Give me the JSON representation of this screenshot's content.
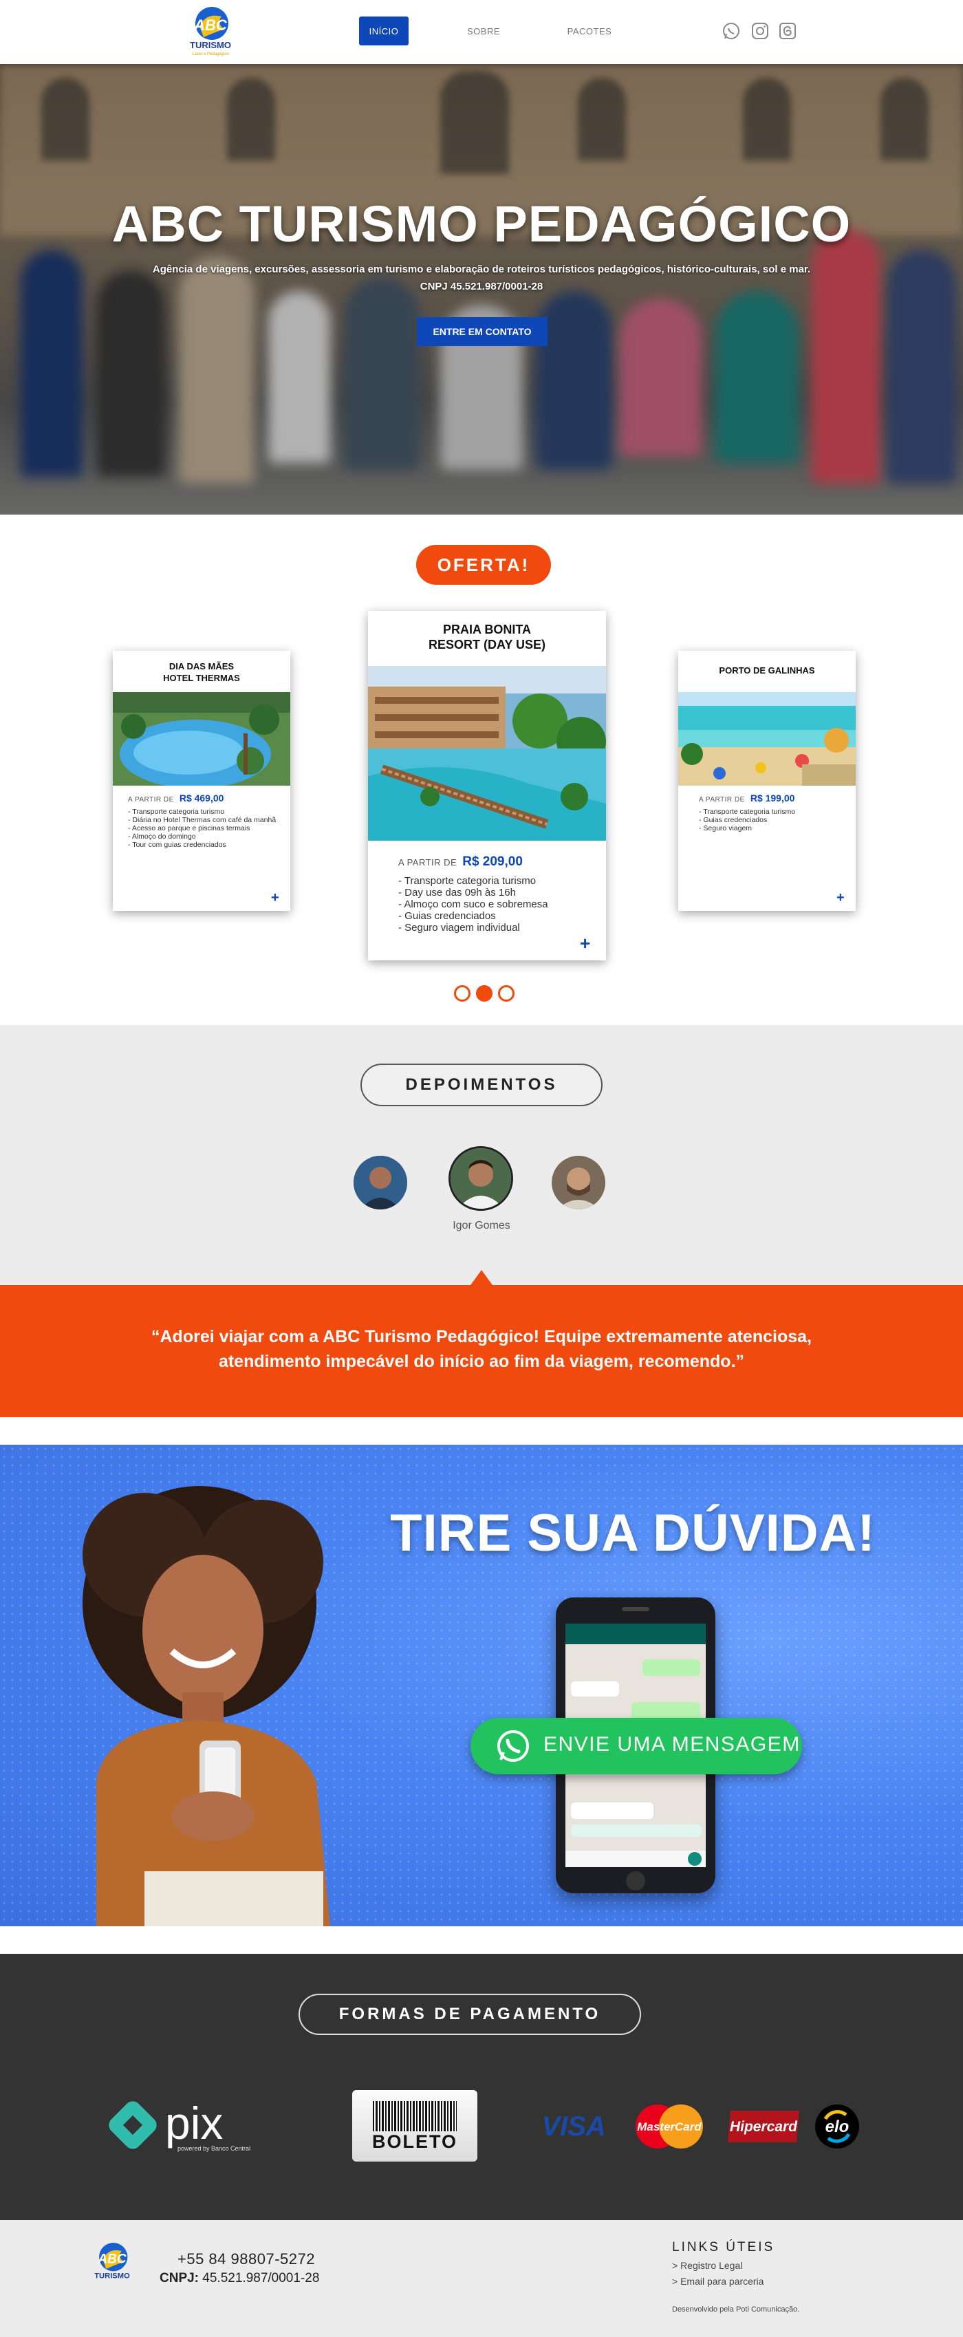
{
  "header": {
    "logo_text": "ABC TURISMO",
    "nav": [
      "INÍCIO",
      "SOBRE",
      "PACOTES"
    ],
    "social_icons": [
      "whatsapp-icon",
      "instagram-icon",
      "threads-icon"
    ]
  },
  "hero": {
    "title": "ABC TURISMO PEDAGÓGICO",
    "subtitle": "Agência de viagens, excursões, assessoria em turismo e elaboração de roteiros turísticos pedagógicos, histórico-culturais, sol e mar.",
    "cnpj": "CNPJ 45.521.987/0001-28",
    "cta": "ENTRE EM CONTATO"
  },
  "offers": {
    "badge": "OFERTA!",
    "price_label": "A PARTIR DE",
    "cards": [
      {
        "title_line1": "DIA DAS MÃES",
        "title_line2": "HOTEL THERMAS",
        "price": "R$ 469,00",
        "features": [
          "- Transporte categoria turismo",
          "- Diária no Hotel Thermas com café da manhã",
          "- Acesso ao parque e piscinas termais",
          "- Almoço do domingo",
          "- Tour com guias credenciados"
        ]
      },
      {
        "title_line1": "PRAIA BONITA",
        "title_line2": "RESORT (DAY USE)",
        "price": "R$ 209,00",
        "features": [
          "- Transporte categoria turismo",
          "- Day use das 09h às 16h",
          "- Almoço com suco e sobremesa",
          "- Guias credenciados",
          "- Seguro viagem individual"
        ]
      },
      {
        "title_line1": "PORTO DE GALINHAS",
        "title_line2": "",
        "price": "R$ 199,00",
        "features": [
          "- Transporte categoria turismo",
          "- Guias credenciados",
          "- Seguro viagem"
        ]
      }
    ],
    "plus": "+",
    "active_slide": 2,
    "slides": 3
  },
  "testimonials": {
    "heading": "DEPOIMENTOS",
    "active_name": "Igor Gomes",
    "quote_line1": "“Adorei viajar com a ABC Turismo Pedagógico! Equipe extremamente atenciosa,",
    "quote_line2": "atendimento impecável do início ao fim da viagem, recomendo.”"
  },
  "whatsapp": {
    "title": "TIRE SUA DÚVIDA!",
    "button": "ENVIE UMA MENSAGEM"
  },
  "payment": {
    "heading": "FORMAS DE PAGAMENTO",
    "pix": "pix",
    "pix_sub": "powered by Banco Central",
    "boleto": "BOLETO",
    "cards": [
      "VISA",
      "MasterCard",
      "Hipercard",
      "elo"
    ]
  },
  "footer": {
    "phone": "+55 84 98807-5272",
    "cnpj_label": "CNPJ:",
    "cnpj_value": "45.521.987/0001-28",
    "links_title": "LINKS ÚTEIS",
    "links": [
      "> Registro Legal",
      "> Email para parceria"
    ],
    "dev": "Desenvolvido pela Poti Comunicação."
  },
  "colors": {
    "brand_blue": "#0d47b8",
    "brand_orange": "#f04a0f",
    "whatsapp_green": "#22c35e",
    "dark_bg": "#333333"
  }
}
